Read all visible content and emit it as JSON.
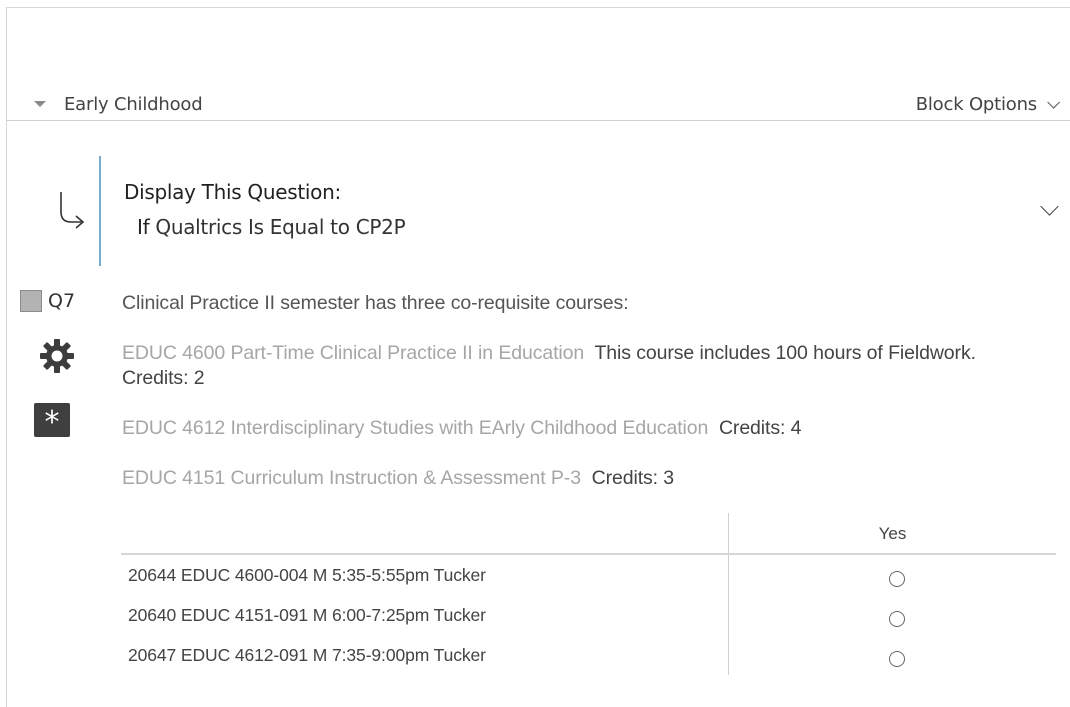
{
  "block": {
    "name": "Early Childhood",
    "options_label": "Block Options"
  },
  "display_logic": {
    "title": "Display This Question:",
    "if_keyword": "If",
    "condition": "Qualtrics Is Equal to CP2P"
  },
  "question": {
    "number": "Q7",
    "required_symbol": "*",
    "text": "Clinical Practice II semester has three co-requisite courses:",
    "courses": [
      {
        "code": "EDUC 4600 Part-Time Clinical Practice II in Education",
        "detail": "This course includes 100 hours of Fieldwork. Credits:  2"
      },
      {
        "code": "EDUC 4612 Interdisciplinary Studies with EArly Childhood Education",
        "detail": "Credits: 4"
      },
      {
        "code": "EDUC 4151 Curriculum Instruction & Assessment P-3",
        "detail": "Credits: 3"
      }
    ],
    "matrix": {
      "column_header": "Yes",
      "rows": [
        "20644 EDUC 4600-004 M 5:35-5:55pm Tucker",
        "20640 EDUC 4151-091 M 6:00-7:25pm Tucker",
        "20647 EDUC 4612-091 M 7:35-9:00pm Tucker"
      ]
    }
  },
  "icons": {
    "block_toggle": "caret-down-icon",
    "block_options": "chevron-down-icon",
    "logic": "branch-arrow-icon",
    "logic_expand": "chevron-down-icon",
    "settings": "gear-icon",
    "required": "asterisk-icon"
  },
  "colors": {
    "logic_rule": "#4c8dbf",
    "course_code": "#a6a6a6",
    "required_badge": "#3f3f3f"
  }
}
